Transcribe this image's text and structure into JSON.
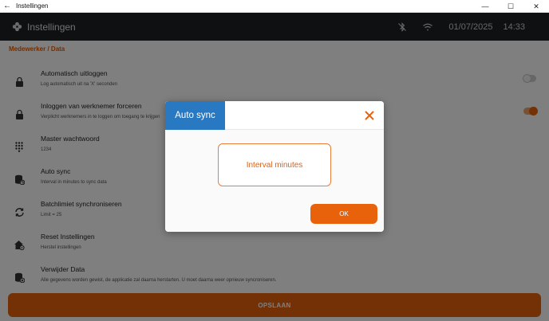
{
  "window": {
    "title": "Instellingen",
    "back_glyph": "←",
    "minimize_glyph": "—",
    "maximize_glyph": "☐",
    "close_glyph": "✕"
  },
  "header": {
    "title": "Instellingen",
    "date": "01/07/2025",
    "time": "14:33"
  },
  "breadcrumb": "Medewerker / Data",
  "settings": [
    {
      "title": "Automatisch uitloggen",
      "description": "Log automatisch uit na 'X' seconden",
      "icon": "lock-icon",
      "toggle": "off"
    },
    {
      "title": "Inloggen van werknemer forceren",
      "description": "Verplicht werknemers in te loggen om toegang te krijgen",
      "icon": "lock-icon",
      "toggle": "on"
    },
    {
      "title": "Master wachtwoord",
      "description": "1234",
      "icon": "keypad-icon"
    },
    {
      "title": "Auto sync",
      "description": "Interval in minutes to sync data",
      "icon": "database-sync-icon"
    },
    {
      "title": "Batchlimiet synchroniseren",
      "description": "Limit = 25",
      "icon": "sync-arrows-icon"
    },
    {
      "title": "Reset Instellingen",
      "description": "Herstel instellingen",
      "icon": "home-gear-icon"
    },
    {
      "title": "Verwijder Data",
      "description": "Alle gegevens worden gewist, de applicatie zal daarna herstarten. U moet daarna weer opnieuw syncroniseren.",
      "icon": "database-delete-icon"
    }
  ],
  "save_button": "OPSLAAN",
  "dialog": {
    "title": "Auto sync",
    "input_placeholder": "Interval minutes",
    "ok_label": "OK"
  },
  "colors": {
    "accent": "#e8620c",
    "dialog_title_bg": "#2979c2",
    "header_bg": "#1e2125"
  }
}
